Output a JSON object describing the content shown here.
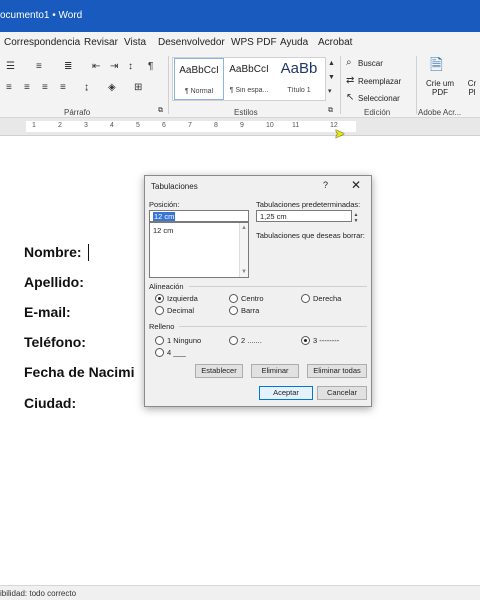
{
  "window": {
    "title": "ocumento1  •  Word"
  },
  "ribbon_tabs": [
    {
      "label": "Correspondencia"
    },
    {
      "label": "Revisar"
    },
    {
      "label": "Vista"
    },
    {
      "label": "Desenvolvedor"
    },
    {
      "label": "WPS PDF"
    },
    {
      "label": "Ayuda"
    },
    {
      "label": "Acrobat"
    }
  ],
  "groups": {
    "paragraph": "Párrafo",
    "styles": "Estilos",
    "editing": "Edición",
    "adobe": "Adobe Acr..."
  },
  "styles": [
    {
      "sample": "AaBbCcI",
      "name": "¶ Normal"
    },
    {
      "sample": "AaBbCcI",
      "name": "¶ Sin espa..."
    },
    {
      "sample": "AaBb",
      "name": "Título 1"
    }
  ],
  "editing": {
    "find": "Buscar",
    "replace": "Reemplazar",
    "select": "Seleccionar"
  },
  "adobe": {
    "create_pdf": "Crie um PDF",
    "create_short": "Cr Pl"
  },
  "ruler_numbers": [
    "1",
    "2",
    "3",
    "4",
    "5",
    "6",
    "7",
    "8",
    "9",
    "10",
    "11",
    "12"
  ],
  "document": {
    "lines": [
      "Nombre:",
      "Apellido:",
      "E-mail:",
      "Teléfono:",
      "Fecha de Nacimi",
      "Ciudad:"
    ]
  },
  "status": {
    "text": "ibilidad: todo correcto"
  },
  "dialog": {
    "title": "Tabulaciones",
    "help": "?",
    "close": "✕",
    "position_label": "Posición:",
    "position_value": "12 cm",
    "position_list": [
      "12 cm"
    ],
    "default_tabs_label": "Tabulaciones predeterminadas:",
    "default_tabs_value": "1,25 cm",
    "clear_label": "Tabulaciones que deseas borrar:",
    "alignment_label": "Alineación",
    "alignment": [
      {
        "label": "Izquierda",
        "selected": true
      },
      {
        "label": "Centro",
        "selected": false
      },
      {
        "label": "Derecha",
        "selected": false
      },
      {
        "label": "Decimal",
        "selected": false
      },
      {
        "label": "Barra",
        "selected": false
      }
    ],
    "leader_label": "Relleno",
    "leader": [
      {
        "label": "1 Ninguno",
        "selected": false
      },
      {
        "label": "2 .......",
        "selected": false
      },
      {
        "label": "3 --------",
        "selected": true
      },
      {
        "label": "4 ___",
        "selected": false
      }
    ],
    "buttons": {
      "set": "Establecer",
      "clear": "Eliminar",
      "clear_all": "Eliminar todas",
      "ok": "Aceptar",
      "cancel": "Cancelar"
    }
  }
}
